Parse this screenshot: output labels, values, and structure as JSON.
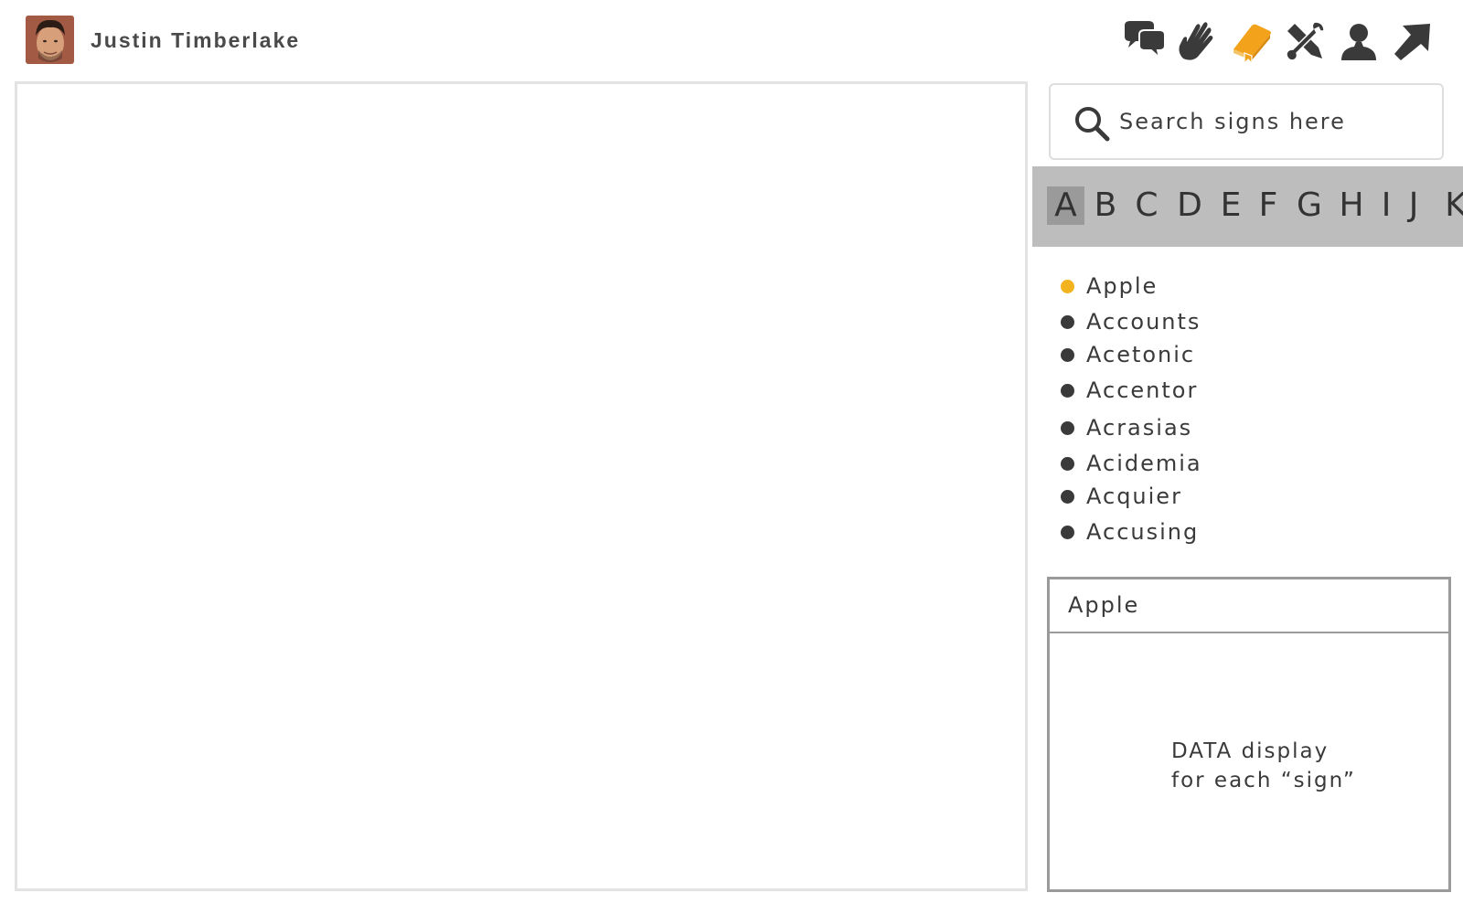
{
  "user": {
    "name": "Justin Timberlake"
  },
  "toolbar": {
    "icons": [
      "chat-icon",
      "hand-sign-icon",
      "dictionary-book-icon",
      "tools-icon",
      "profile-icon",
      "share-arrow-icon"
    ],
    "active": "dictionary-book-icon",
    "active_color": "#f2a31b",
    "icon_color": "#3a3a3a"
  },
  "search": {
    "placeholder": "Search signs here",
    "value": ""
  },
  "alphabet": {
    "letters": [
      "A",
      "B",
      "C",
      "D",
      "E",
      "F",
      "G",
      "H",
      "I",
      "J",
      "K"
    ],
    "active": "A"
  },
  "signs": [
    {
      "label": "Apple",
      "selected": true
    },
    {
      "label": "Accounts",
      "selected": false
    },
    {
      "label": "Acetonic",
      "selected": false
    },
    {
      "label": "Accentor",
      "selected": false
    },
    {
      "label": "Acrasias",
      "selected": false
    },
    {
      "label": "Acidemia",
      "selected": false
    },
    {
      "label": "Acquier",
      "selected": false
    },
    {
      "label": "Accusing",
      "selected": false
    }
  ],
  "detail": {
    "title": "Apple",
    "body_line1": "DATA display",
    "body_line2": "for each “sign”"
  },
  "colors": {
    "accent": "#f2b31f",
    "alphabar": "#bdbdbd",
    "alpha_active": "#9a9a9a"
  }
}
